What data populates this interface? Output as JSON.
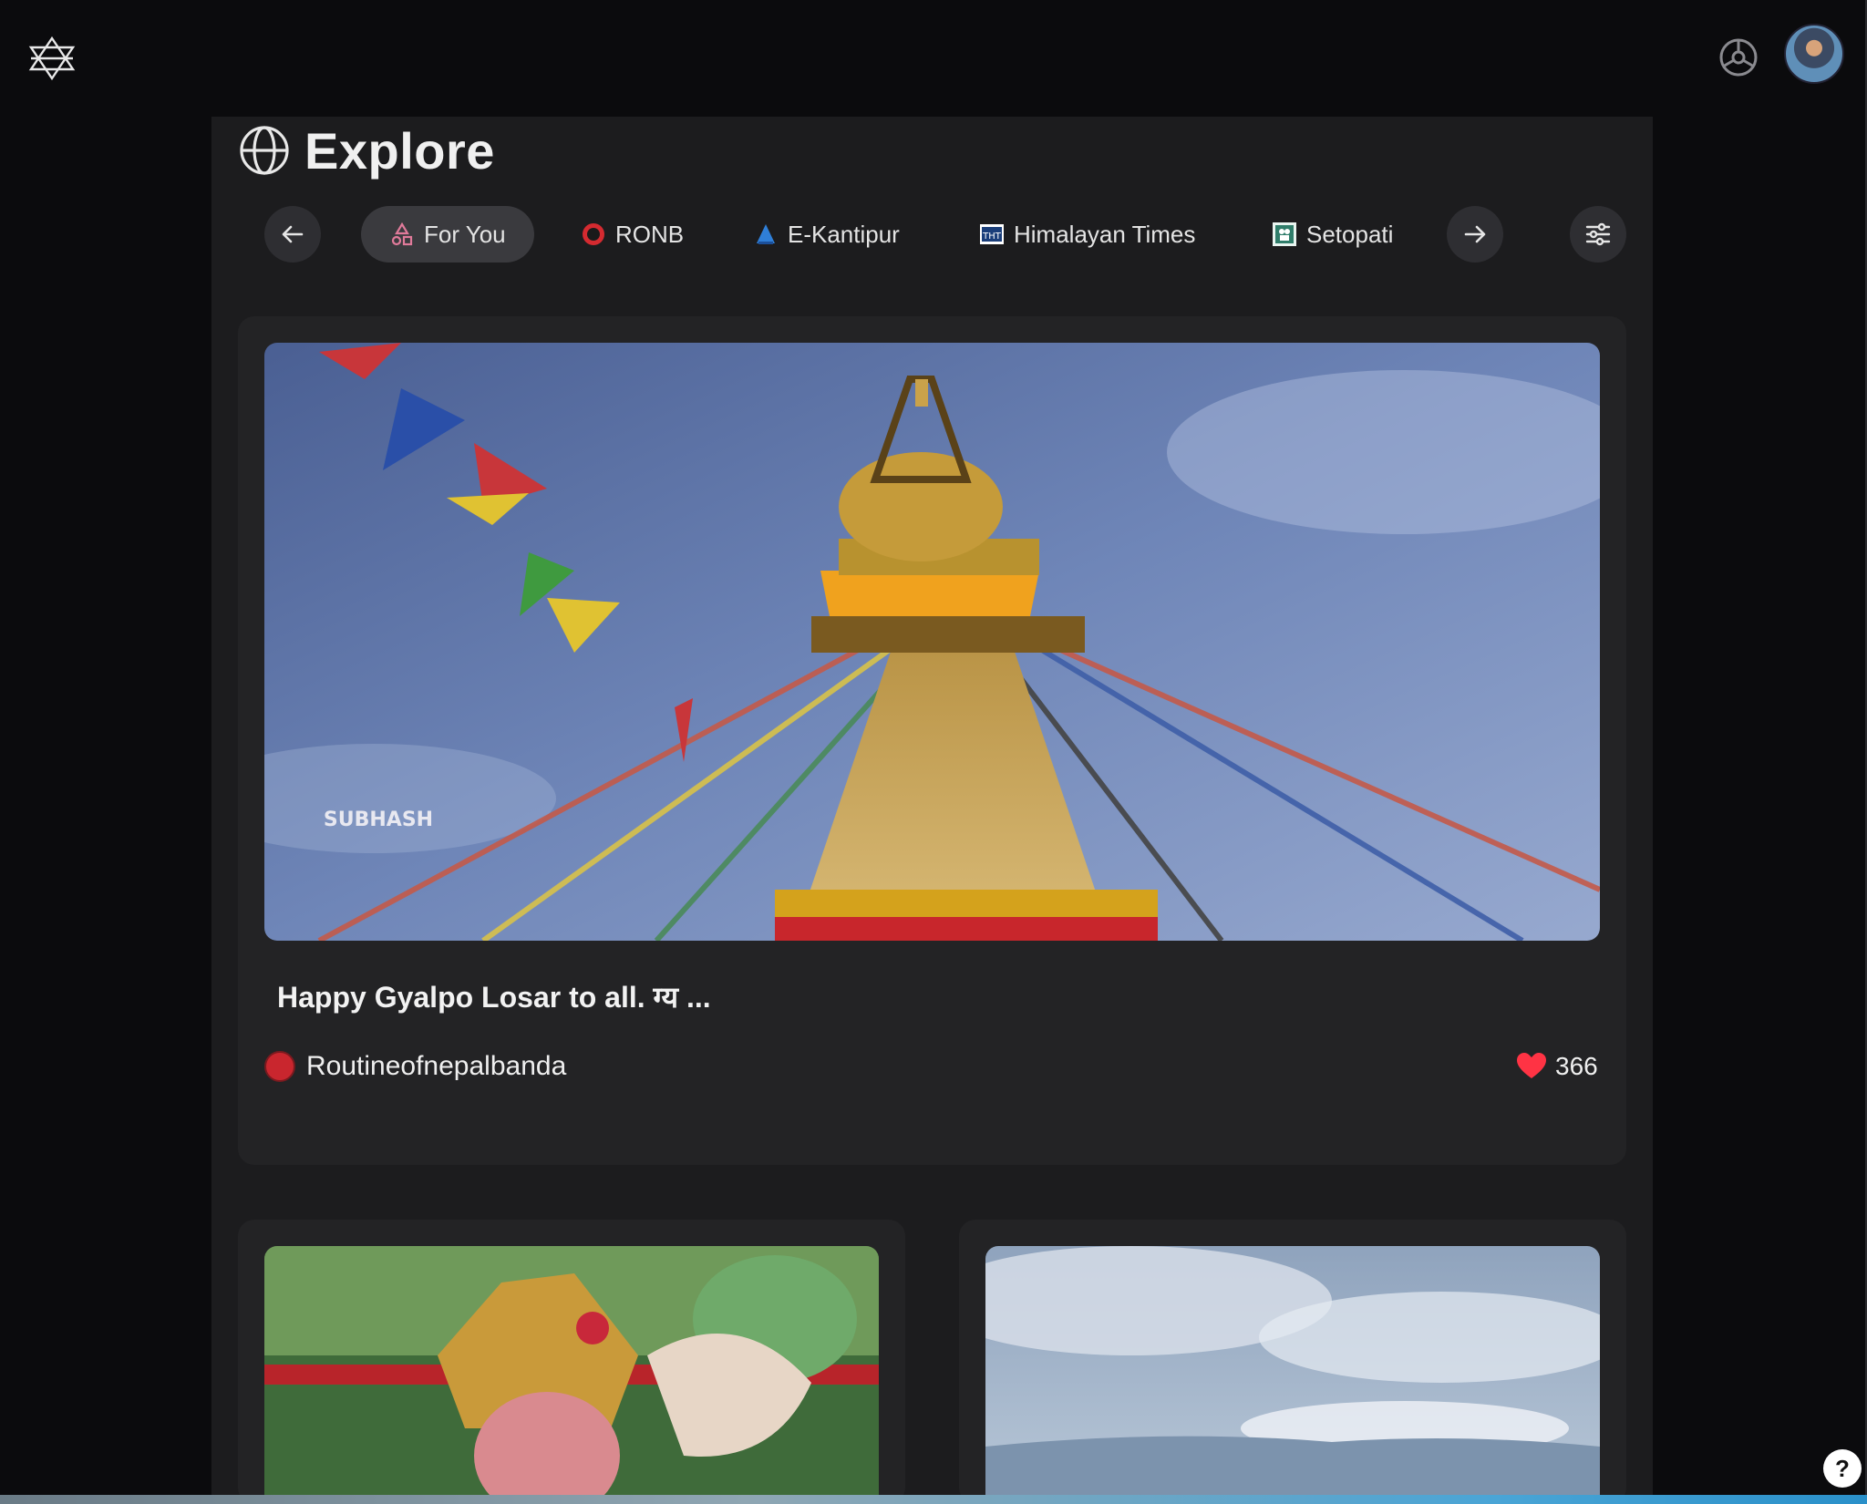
{
  "header": {
    "logo_icon": "app-logo-icon",
    "status_icon": "wheel-icon",
    "avatar": "user-avatar"
  },
  "page": {
    "title": "Explore",
    "title_icon": "globe-icon"
  },
  "tabs": {
    "prev_icon": "arrow-left-icon",
    "next_icon": "arrow-right-icon",
    "filter_icon": "sliders-icon",
    "items": [
      {
        "label": "For You",
        "icon": "shapes-icon",
        "active": true
      },
      {
        "label": "RONB",
        "icon": "ronb-logo-icon",
        "active": false
      },
      {
        "label": "E-Kantipur",
        "icon": "ekantipur-logo-icon",
        "active": false
      },
      {
        "label": "Himalayan Times",
        "icon": "tht-logo-icon",
        "active": false
      },
      {
        "label": "Setopati",
        "icon": "setopati-logo-icon",
        "active": false
      }
    ]
  },
  "featured_post": {
    "image_watermark": "SUBHASH",
    "title": "Happy Gyalpo Losar to all. ग्य ...",
    "author": "Routineofnepalbanda",
    "likes": "366"
  },
  "help_label": "?",
  "colors": {
    "background": "#0b0b0d",
    "panel": "#1c1c1e",
    "card": "#232325",
    "heart": "#ff3344"
  }
}
